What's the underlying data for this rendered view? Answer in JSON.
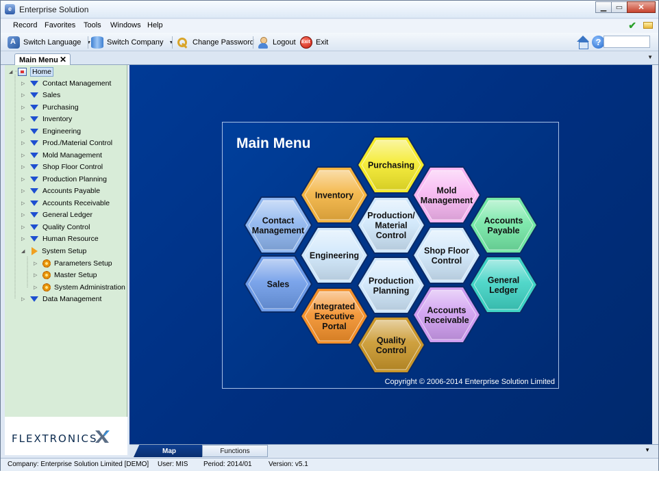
{
  "window": {
    "title": "Enterprise Solution"
  },
  "menu": [
    "Record",
    "Favorites",
    "Tools",
    "Windows",
    "Help"
  ],
  "toolbar": {
    "switch_language": "Switch Language",
    "switch_company": "Switch Company",
    "change_password": "Change Password",
    "logout": "Logout",
    "exit": "Exit"
  },
  "doc_tab": {
    "label": "Main Menu"
  },
  "tree": {
    "root": "Home",
    "modules": [
      "Contact Management",
      "Sales",
      "Purchasing",
      "Inventory",
      "Engineering",
      "Prod./Material Control",
      "Mold Management",
      "Shop Floor Control",
      "Production Planning",
      "Accounts Payable",
      "Accounts Receivable",
      "General Ledger",
      "Quality Control",
      "Human Resource"
    ],
    "system_setup": {
      "label": "System Setup",
      "children": [
        "Parameters Setup",
        "Master Setup",
        "System Administration"
      ]
    },
    "data_management": "Data Management"
  },
  "logo": {
    "text": "FLEXTRONICS"
  },
  "main_menu": {
    "title": "Main Menu",
    "copyright": "Copyright © 2006-2014 Enterprise Solution Limited",
    "tiles": [
      {
        "id": "purchasing",
        "lines": [
          "Purchasing"
        ],
        "color": "#f4ea2a"
      },
      {
        "id": "inventory",
        "lines": [
          "Inventory"
        ],
        "color": "#f3b340"
      },
      {
        "id": "mold-management",
        "lines": [
          "Mold",
          "Management"
        ],
        "color": "#f7b6f2"
      },
      {
        "id": "contact-management",
        "lines": [
          "Contact",
          "Management"
        ],
        "color": "#8cb4ee"
      },
      {
        "id": "production-material-control",
        "lines": [
          "Production/",
          "Material",
          "Control"
        ],
        "color": "#cfe7fb"
      },
      {
        "id": "accounts-payable",
        "lines": [
          "Accounts",
          "Payable"
        ],
        "color": "#73e7a5"
      },
      {
        "id": "engineering",
        "lines": [
          "Engineering"
        ],
        "color": "#cfe7fb"
      },
      {
        "id": "shop-floor-control",
        "lines": [
          "Shop Floor",
          "Control"
        ],
        "color": "#cfe7fb"
      },
      {
        "id": "sales",
        "lines": [
          "Sales"
        ],
        "color": "#6d9be8"
      },
      {
        "id": "production-planning",
        "lines": [
          "Production",
          "Planning"
        ],
        "color": "#cfe7fb"
      },
      {
        "id": "general-ledger",
        "lines": [
          "General",
          "Ledger"
        ],
        "color": "#3fd3c4"
      },
      {
        "id": "integrated-executive-portal",
        "lines": [
          "Integrated",
          "Executive",
          "Portal"
        ],
        "color": "#f3902a"
      },
      {
        "id": "accounts-receivable",
        "lines": [
          "Accounts",
          "Receivable"
        ],
        "color": "#cf9df0"
      },
      {
        "id": "quality-control",
        "lines": [
          "Quality",
          "Control"
        ],
        "color": "#c9962a"
      }
    ]
  },
  "bottom_tabs": {
    "map": "Map",
    "functions": "Functions"
  },
  "status": {
    "company": "Company:  Enterprise Solution Limited [DEMO]",
    "user": "User:  MIS",
    "period": "Period:  2014/01",
    "version": "Version:  v5.1"
  }
}
